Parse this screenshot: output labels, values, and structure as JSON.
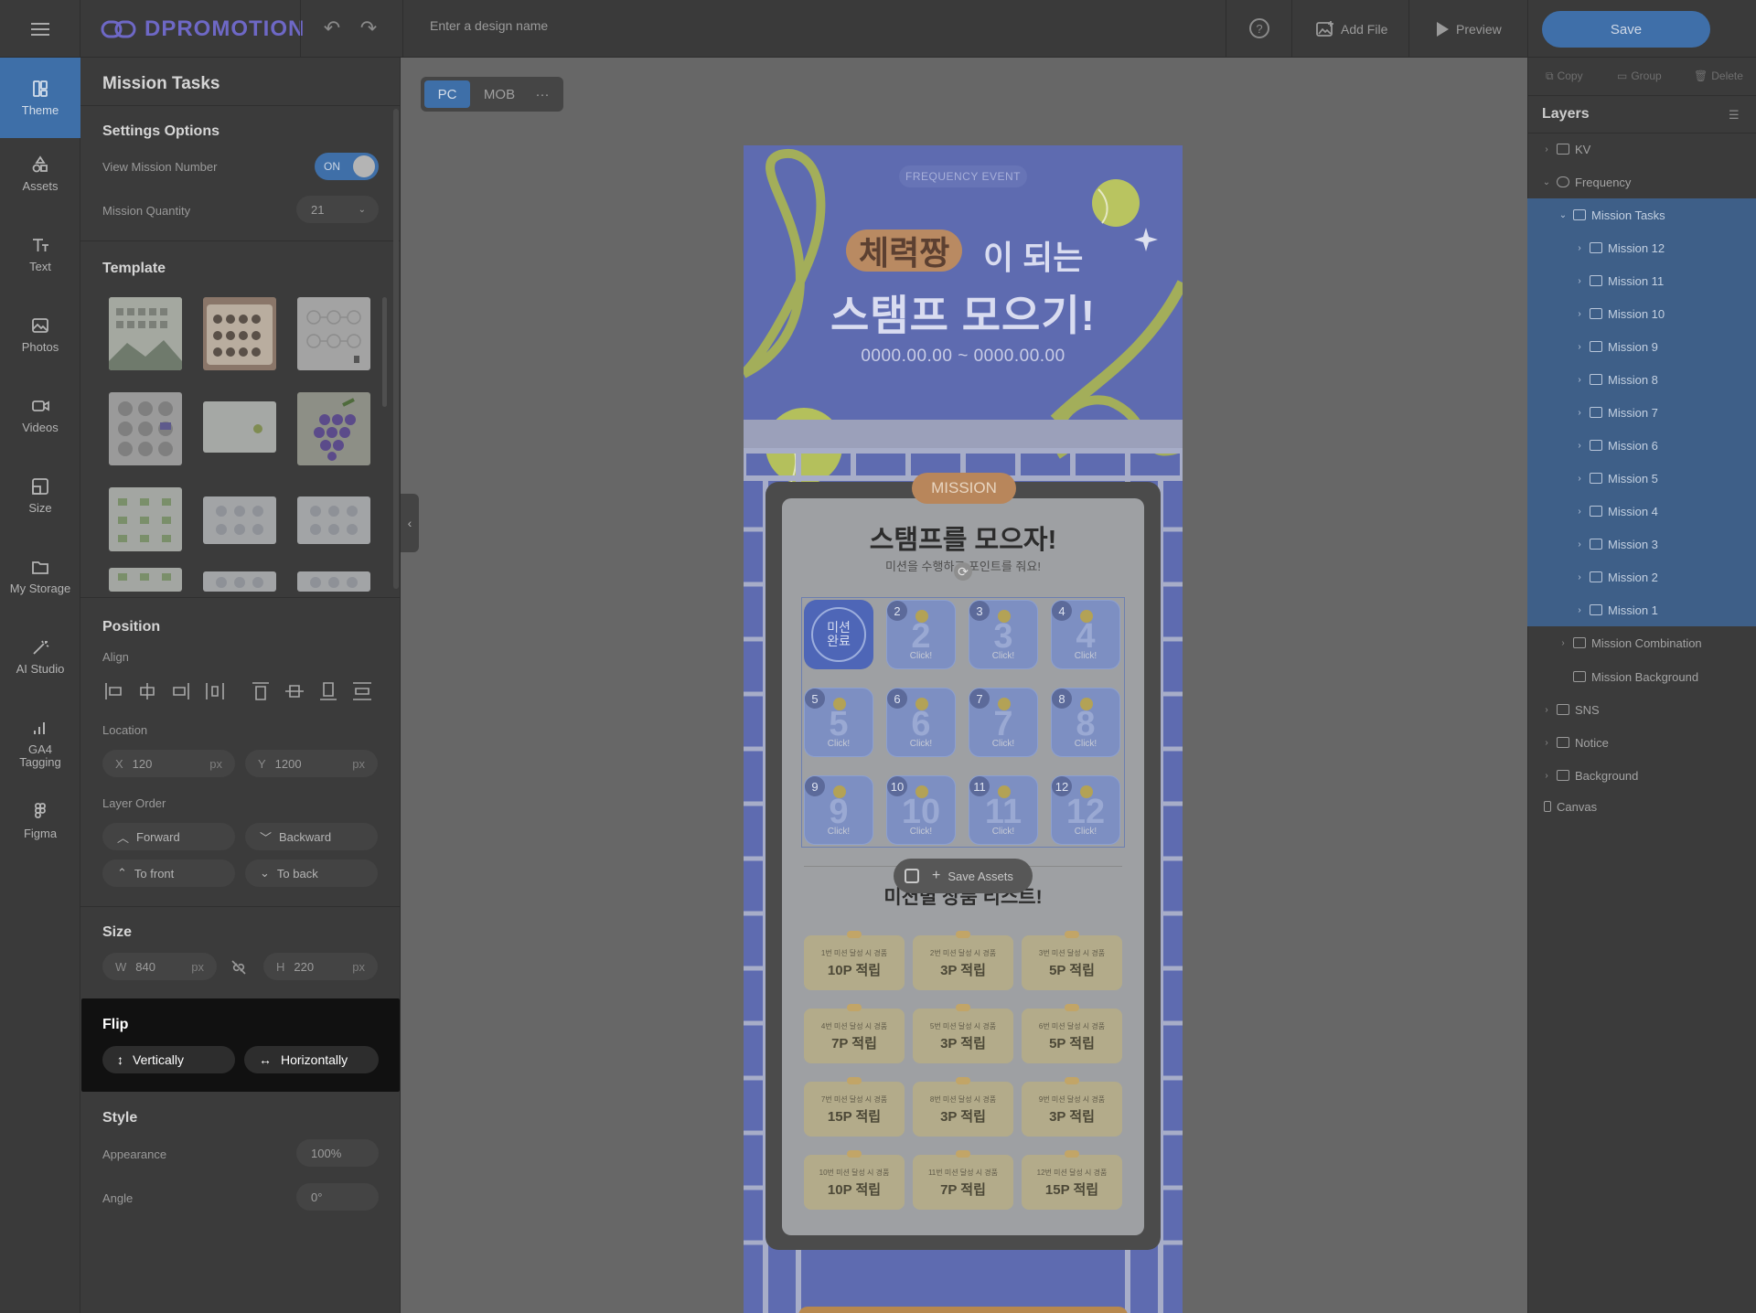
{
  "app": {
    "logo": "DPROMOTION",
    "design_name_placeholder": "Enter a design name"
  },
  "topbar": {
    "add_file": "Add File",
    "preview": "Preview",
    "save": "Save"
  },
  "rail": [
    {
      "label": "Theme",
      "icon": "theme-icon"
    },
    {
      "label": "Assets",
      "icon": "assets-icon"
    },
    {
      "label": "Text",
      "icon": "text-icon"
    },
    {
      "label": "Photos",
      "icon": "photos-icon"
    },
    {
      "label": "Videos",
      "icon": "videos-icon"
    },
    {
      "label": "Size",
      "icon": "size-icon"
    },
    {
      "label": "My Storage",
      "icon": "folder-icon"
    },
    {
      "label": "AI Studio",
      "icon": "magic-wand-icon"
    },
    {
      "label": "GA4 Tagging",
      "icon": "analytics-icon"
    },
    {
      "label": "Figma",
      "icon": "figma-icon"
    }
  ],
  "panel": {
    "title": "Mission Tasks",
    "settings": {
      "heading": "Settings Options",
      "view_mission_number": "View Mission Number",
      "toggle": "ON",
      "mission_quantity_label": "Mission Quantity",
      "mission_quantity": "21"
    },
    "template": {
      "heading": "Template"
    },
    "position": {
      "heading": "Position",
      "align": "Align",
      "location": "Location",
      "x_label": "X",
      "x": "120",
      "y_label": "Y",
      "y": "1200",
      "unit": "px"
    },
    "layer_order": {
      "label": "Layer Order",
      "forward": "Forward",
      "backward": "Backward",
      "to_front": "To front",
      "to_back": "To back"
    },
    "size": {
      "heading": "Size",
      "w_label": "W",
      "w": "840",
      "h_label": "H",
      "h": "220",
      "unit": "px"
    },
    "flip": {
      "heading": "Flip",
      "vertically": "Vertically",
      "horizontally": "Horizontally"
    },
    "style": {
      "heading": "Style",
      "appearance_label": "Appearance",
      "appearance": "100%",
      "angle_label": "Angle",
      "angle": "0°"
    }
  },
  "canvas": {
    "tab_pc": "PC",
    "tab_mob": "MOB",
    "more": "···"
  },
  "design": {
    "badge": "FREQUENCY EVENT",
    "headline_highlight": "체력짱",
    "headline_rest": "이 되는",
    "headline_2": "스탬프 모으기!",
    "date": "0000.00.00 ~ 0000.00.00",
    "mission_tag": "MISSION",
    "board_title": "스탬프를 모으자!",
    "board_sub": "미션을 수행하고 포인트를 줘요!",
    "completed_stamp": "미션 완료",
    "click_label": "Click!",
    "stamp_numbers": [
      "2",
      "3",
      "4",
      "5",
      "6",
      "7",
      "8",
      "9",
      "10",
      "11",
      "12"
    ],
    "save_assets": "Save Assets",
    "list_title": "미션별 상품 리스트!",
    "rewards": [
      {
        "cond": "1번 미션 달성 시 경품",
        "points": "10P 적립"
      },
      {
        "cond": "2번 미션 달성 시 경품",
        "points": "3P 적립"
      },
      {
        "cond": "3번 미션 달성 시 경품",
        "points": "5P 적립"
      },
      {
        "cond": "4번 미션 달성 시 경품",
        "points": "7P 적립"
      },
      {
        "cond": "5번 미션 달성 시 경품",
        "points": "3P 적립"
      },
      {
        "cond": "6번 미션 달성 시 경품",
        "points": "5P 적립"
      },
      {
        "cond": "7번 미션 달성 시 경품",
        "points": "15P 적립"
      },
      {
        "cond": "8번 미션 달성 시 경품",
        "points": "3P 적립"
      },
      {
        "cond": "9번 미션 달성 시 경품",
        "points": "3P 적립"
      },
      {
        "cond": "10번 미션 달성 시 경품",
        "points": "10P 적립"
      },
      {
        "cond": "11번 미션 달성 시 경품",
        "points": "7P 적립"
      },
      {
        "cond": "12번 미션 달성 시 경품",
        "points": "15P 적립"
      }
    ]
  },
  "layers_panel": {
    "copy": "Copy",
    "group": "Group",
    "delete": "Delete",
    "title": "Layers",
    "items": [
      {
        "label": "KV",
        "type": "folder"
      },
      {
        "label": "Frequency",
        "type": "component"
      },
      {
        "label": "Mission Tasks",
        "type": "list",
        "selected": true
      },
      {
        "label": "Mission 12",
        "type": "list"
      },
      {
        "label": "Mission 11",
        "type": "list"
      },
      {
        "label": "Mission 10",
        "type": "list"
      },
      {
        "label": "Mission 9",
        "type": "list"
      },
      {
        "label": "Mission 8",
        "type": "list"
      },
      {
        "label": "Mission 7",
        "type": "list"
      },
      {
        "label": "Mission 6",
        "type": "list"
      },
      {
        "label": "Mission 5",
        "type": "list"
      },
      {
        "label": "Mission 4",
        "type": "list"
      },
      {
        "label": "Mission 3",
        "type": "list"
      },
      {
        "label": "Mission 2",
        "type": "list"
      },
      {
        "label": "Mission 1",
        "type": "list"
      },
      {
        "label": "Mission Combination",
        "type": "group"
      },
      {
        "label": "Mission Background",
        "type": "frame"
      },
      {
        "label": "SNS",
        "type": "folder"
      },
      {
        "label": "Notice",
        "type": "folder"
      },
      {
        "label": "Background",
        "type": "folder"
      },
      {
        "label": "Canvas",
        "type": "canvas"
      }
    ]
  },
  "colors": {
    "accent": "#3e6fa8",
    "design_bg": "#5e6bb0",
    "flip_panel": "#111111",
    "overlay": "#676767"
  }
}
